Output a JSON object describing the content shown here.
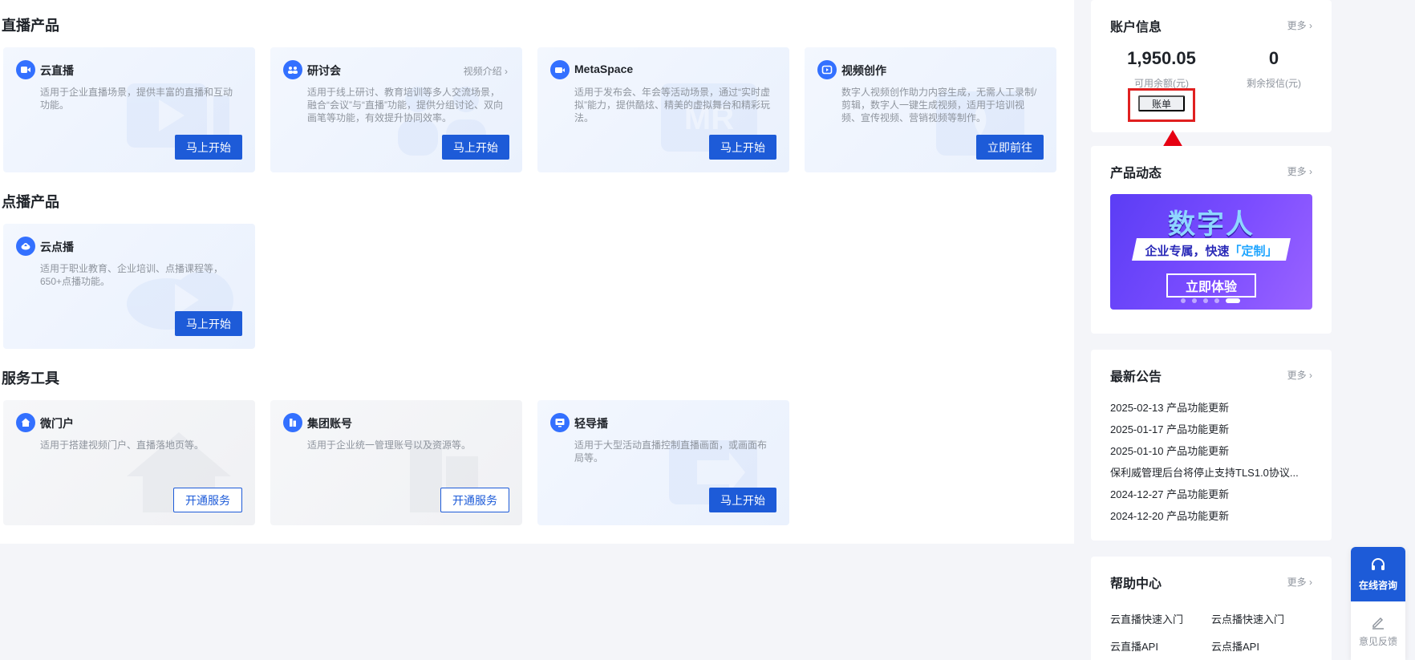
{
  "sections": {
    "live": {
      "title": "直播产品",
      "cards": [
        {
          "title": "云直播",
          "desc": "适用于企业直播场景，提供丰富的直播和互动功能。",
          "button": "马上开始",
          "icon": "video-icon"
        },
        {
          "title": "研讨会",
          "desc": "适用于线上研讨、教育培训等多人交流场景，融合“会议”与“直播”功能，提供分组讨论、双向画笔等功能，有效提升协同效率。",
          "link": "视频介绍",
          "button": "马上开始",
          "icon": "group-icon"
        },
        {
          "title": "MetaSpace",
          "desc": "适用于发布会、年会等活动场景，通过“实时虚拟”能力，提供酷炫、精美的虚拟舞台和精彩玩法。",
          "button": "马上开始",
          "icon": "camera-icon"
        },
        {
          "title": "视频创作",
          "desc": "数字人视频创作助力内容生成，无需人工录制/剪辑，数字人一键生成视频，适用于培训视频、宣传视频、营销视频等制作。",
          "button": "立即前往",
          "icon": "video-edit-icon"
        }
      ]
    },
    "vod": {
      "title": "点播产品",
      "cards": [
        {
          "title": "云点播",
          "desc": "适用于职业教育、企业培训、点播课程等，650+点播功能。",
          "button": "马上开始",
          "icon": "cloud-upload-icon"
        }
      ]
    },
    "tools": {
      "title": "服务工具",
      "cards": [
        {
          "title": "微门户",
          "desc": "适用于搭建视频门户、直播落地页等。",
          "button": "开通服务",
          "icon": "home-icon"
        },
        {
          "title": "集团账号",
          "desc": "适用于企业统一管理账号以及资源等。",
          "button": "开通服务",
          "icon": "building-icon"
        },
        {
          "title": "轻导播",
          "desc": "适用于大型活动直播控制直播画面，或画面布局等。",
          "button": "马上开始",
          "icon": "monitor-icon"
        }
      ]
    }
  },
  "account": {
    "title": "账户信息",
    "more": "更多",
    "balance": "1,950.05",
    "balance_label": "可用余额(元)",
    "credit": "0",
    "credit_label": "剩余授信(元)",
    "bill_button": "账单"
  },
  "news": {
    "title": "产品动态",
    "more": "更多",
    "banner_title": "数字人",
    "banner_sub_prefix": "企业专属，快速",
    "banner_sub_highlight": "「定制」",
    "banner_cta": "立即体验"
  },
  "notices": {
    "title": "最新公告",
    "more": "更多",
    "items": [
      "2025-02-13 产品功能更新",
      "2025-01-17 产品功能更新",
      "2025-01-10 产品功能更新",
      "保利威管理后台将停止支持TLS1.0协议...",
      "2024-12-27 产品功能更新",
      "2024-12-20 产品功能更新"
    ]
  },
  "help": {
    "title": "帮助中心",
    "more": "更多",
    "items": [
      "云直播快速入门",
      "云点播快速入门",
      "云直播API",
      "云点播API"
    ]
  },
  "float": {
    "online": "在线咨询",
    "feedback": "意见反馈"
  },
  "colors": {
    "primary": "#1d5bd8",
    "icon_blue": "#3370ff",
    "highlight_red": "#e02020"
  }
}
